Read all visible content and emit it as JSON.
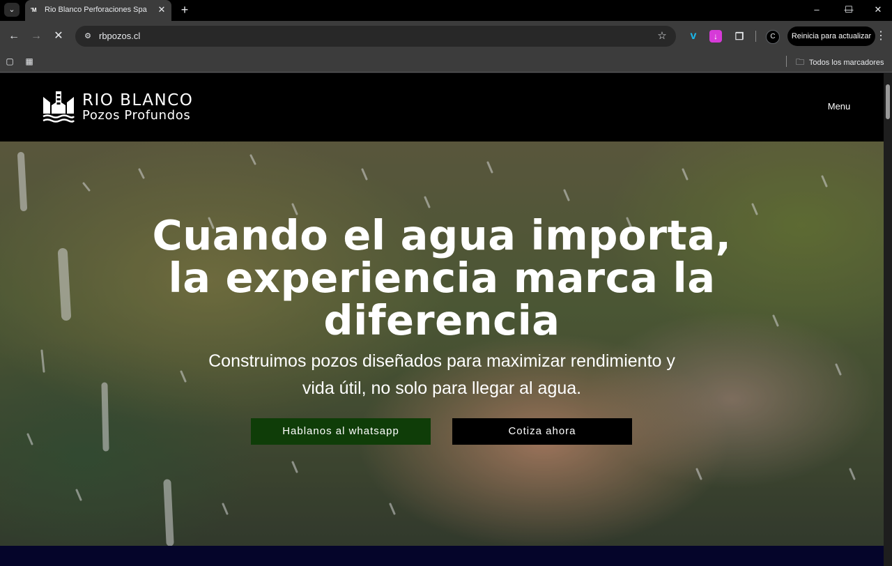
{
  "browser": {
    "tab": {
      "favicon_text": "'M",
      "title": "Rio Blanco Perforaciones Spa | P"
    },
    "url": "rbpozos.cl",
    "update_label": "Reinicia para actualizar",
    "profile_initial": "C",
    "bookmarks": {
      "all_label": "Todos los marcadores"
    }
  },
  "site": {
    "logo": {
      "name": "RIO BLANCO",
      "subtitle": "Pozos Profundos"
    },
    "menu_label": "Menu",
    "hero": {
      "title": "Cuando el agua importa, la experiencia marca la diferencia",
      "subtitle": "Construimos pozos diseñados para maximizar rendimiento y vida útil, no solo para llegar al agua.",
      "primary_cta": "Hablanos al whatsapp",
      "secondary_cta": "Cotiza ahora"
    }
  },
  "colors": {
    "whatsapp_button": "#0f3d08",
    "quote_button": "#000000",
    "header_bg": "#000000",
    "next_section_bg": "#05052a"
  }
}
